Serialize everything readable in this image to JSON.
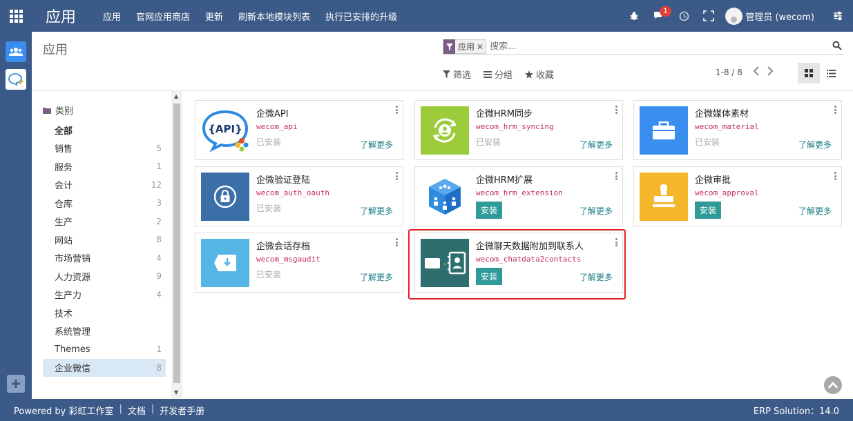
{
  "topbar": {
    "app_title": "应用",
    "menu": [
      "应用",
      "官网应用商店",
      "更新",
      "刷新本地模块列表",
      "执行已安排的升级"
    ],
    "message_count": "1",
    "user_name": "管理员 (wecom)"
  },
  "control_panel": {
    "title": "应用",
    "facet_label": "应用",
    "search_placeholder": "搜索...",
    "filter_label": "筛选",
    "group_label": "分组",
    "favorite_label": "收藏",
    "pager": "1-8 / 8"
  },
  "side_panel": {
    "header": "类别",
    "items": [
      {
        "label": "全部",
        "count": ""
      },
      {
        "label": "销售",
        "count": "5"
      },
      {
        "label": "服务",
        "count": "1"
      },
      {
        "label": "会计",
        "count": "12"
      },
      {
        "label": "仓库",
        "count": "3"
      },
      {
        "label": "生产",
        "count": "2"
      },
      {
        "label": "网站",
        "count": "8"
      },
      {
        "label": "市场营销",
        "count": "4"
      },
      {
        "label": "人力资源",
        "count": "9"
      },
      {
        "label": "生产力",
        "count": "4"
      },
      {
        "label": "技术",
        "count": ""
      },
      {
        "label": "系统管理",
        "count": ""
      },
      {
        "label": "Themes",
        "count": "1"
      },
      {
        "label": "企业微信",
        "count": "8"
      }
    ]
  },
  "cards": [
    {
      "name": "企微API",
      "technical_name": "wecom_api",
      "status": "已安装",
      "learn_more": "了解更多",
      "icon": "api-bubble-icon",
      "icon_text": "{API}"
    },
    {
      "name": "企微HRM同步",
      "technical_name": "wecom_hrm_syncing",
      "status": "已安装",
      "learn_more": "了解更多",
      "icon": "user-sync-icon",
      "color": "#9ccc3c"
    },
    {
      "name": "企微媒体素材",
      "technical_name": "wecom_material",
      "status": "已安装",
      "learn_more": "了解更多",
      "icon": "briefcase-icon",
      "color": "#3a8ef0"
    },
    {
      "name": "企微验证登陆",
      "technical_name": "wecom_auth_oauth",
      "status": "已安装",
      "learn_more": "了解更多",
      "icon": "lock-icon",
      "color": "#3a6fa8"
    },
    {
      "name": "企微HRM扩展",
      "technical_name": "wecom_hrm_extension",
      "install_label": "安装",
      "learn_more": "了解更多",
      "icon": "users-cube-icon"
    },
    {
      "name": "企微审批",
      "technical_name": "wecom_approval",
      "install_label": "安装",
      "learn_more": "了解更多",
      "icon": "stamp-icon",
      "color": "#f4b62a"
    },
    {
      "name": "企微会话存档",
      "technical_name": "wecom_msgaudit",
      "status": "已安装",
      "learn_more": "了解更多",
      "icon": "archive-download-icon",
      "color": "#55b6e6"
    },
    {
      "name": "企微聊天数据附加到联系人",
      "technical_name": "wecom_chatdata2contacts",
      "install_label": "安装",
      "learn_more": "了解更多",
      "icon": "contacts-card-icon",
      "color": "#2f6e6e"
    }
  ],
  "footer": {
    "powered": "Powered by 彩虹工作室",
    "docs": "文档",
    "dev_manual": "开发者手册",
    "version": "ERP Solution：14.0"
  },
  "colors": {
    "navbar": "#3c5a87",
    "install_button": "#2e9b99",
    "link": "#1b7c86",
    "tech_name": "#c32c6b",
    "highlight": "#e52222"
  }
}
